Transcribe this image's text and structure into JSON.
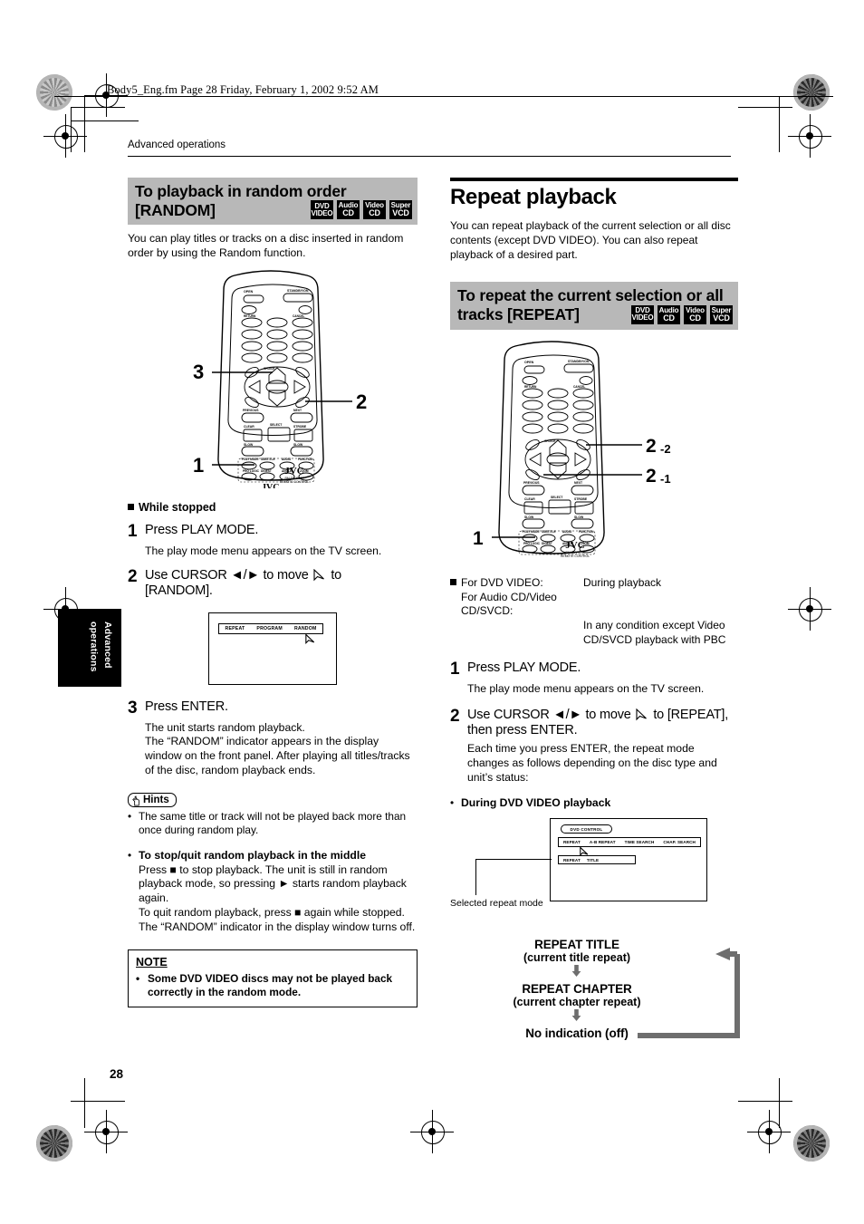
{
  "meta": {
    "fm_header": "Body5_Eng.fm  Page 28  Friday, February 1, 2002  9:52 AM",
    "running_head": "Advanced operations",
    "page_number": "28",
    "side_tab": "Advanced operations"
  },
  "disc_badges": [
    {
      "line1": "DVD",
      "line2": "VIDEO"
    },
    {
      "line1": "Audio",
      "line2": "CD"
    },
    {
      "line1": "Video",
      "line2": "CD"
    },
    {
      "line1": "Super",
      "line2": "VCD"
    }
  ],
  "left_column": {
    "section_heading_line1": "To playback  in random order",
    "section_heading_line2": "[RANDOM]",
    "intro": "You can play titles or tracks on a disc inserted in random order by using the Random function.",
    "remote_callouts": [
      "3",
      "2",
      "1"
    ],
    "remote_brand": "JVC",
    "remote_model_line1": "RM-SXV007A",
    "remote_model_line2": "REMOTE CONTROL",
    "condition_label": "While stopped",
    "steps": [
      {
        "num": "1",
        "title": "Press PLAY MODE.",
        "sub": "The play mode menu appears on the TV screen."
      },
      {
        "num": "2",
        "title": "Use CURSOR ◄/► to move  to [RANDOM].",
        "title_part1": "Use CURSOR ◄/► to move",
        "title_part2": "to",
        "title_part3": "[RANDOM]."
      },
      {
        "num": "3",
        "title": "Press ENTER.",
        "sub": "The unit starts random playback.\nThe “RANDOM” indicator appears in the display window on the front panel. After playing all titles/tracks of the disc, random playback ends."
      }
    ],
    "tv_menu_items": [
      "REPEAT",
      "PROGRAM",
      "RANDOM"
    ],
    "hints_label": "Hints",
    "hints": [
      "The same title or track will not be played back more than once during random play."
    ],
    "stopquit_heading": "To stop/quit random playback in the middle",
    "stopquit_body": "Press ■ to stop playback. The unit is still in random playback mode, so pressing ► starts random playback again.\nTo quit random playback, press ■ again while stopped.  The “RANDOM” indicator in the display window turns off.",
    "note_label": "NOTE",
    "note_body": "Some DVD VIDEO discs may not be played back correctly in the random mode."
  },
  "right_column": {
    "main_title": "Repeat playback",
    "intro": "You can repeat playback of the current selection or all disc contents (except DVD VIDEO). You can also repeat playback of a desired part.",
    "section_heading_line1": "To repeat the current selection or all",
    "section_heading_line2": "tracks [REPEAT]",
    "remote_callouts": [
      "2-2",
      "2-1",
      "1"
    ],
    "remote_brand": "JVC",
    "remote_model_line1": "RM-SXV007A",
    "remote_model_line2": "REMOTE CONTROL",
    "conditions": [
      {
        "label": "For DVD VIDEO:",
        "value": "During playback"
      },
      {
        "label": "For Audio CD/Video CD/SVCD:",
        "value": ""
      },
      {
        "label": "",
        "value": "In any condition except Video CD/SVCD playback with PBC"
      }
    ],
    "steps": [
      {
        "num": "1",
        "title": "Press PLAY MODE.",
        "sub": "The play mode menu appears on the TV screen."
      },
      {
        "num": "2",
        "title_part1": "Use CURSOR ◄/► to move",
        "title_part2": "to [REPEAT],",
        "title_part3": "then press ENTER.",
        "sub": "Each time you press ENTER, the repeat mode changes as follows depending on the disc type and unit’s status:"
      }
    ],
    "during_dvd_label": "During DVD VIDEO playback",
    "osd": {
      "title_pill": "DVD CONTROL",
      "bar_items": [
        "REPEAT",
        "A-B REPEAT",
        "TIME SEARCH",
        "CHAP. SEARCH"
      ],
      "selected_items": [
        "REPEAT",
        "TITLE"
      ],
      "caption": "Selected repeat mode"
    },
    "flow": [
      {
        "main": "REPEAT TITLE",
        "sub": "(current title repeat)"
      },
      {
        "main": "REPEAT CHAPTER",
        "sub": "(current chapter repeat)"
      },
      {
        "main": "No indication (off)",
        "sub": ""
      }
    ]
  },
  "colors": {
    "heading_band": "#b8b8b8",
    "badge_bg": "#000000",
    "flow_arrow": "#6e6e6e"
  }
}
